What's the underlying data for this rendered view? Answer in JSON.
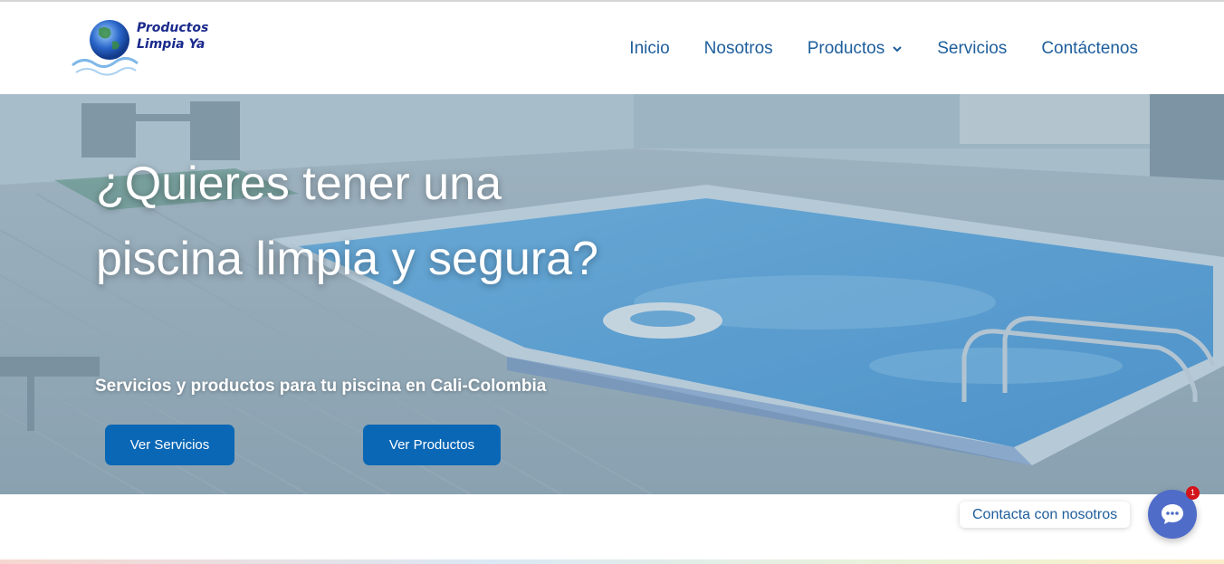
{
  "logo": {
    "line1": "Productos",
    "line2": "Limpia Ya",
    "icon": "globe-water-icon"
  },
  "nav": {
    "items": [
      {
        "label": "Inicio"
      },
      {
        "label": "Nosotros"
      },
      {
        "label": "Productos",
        "icon": "chevron-down-icon"
      },
      {
        "label": "Servicios"
      },
      {
        "label": "Contáctenos"
      }
    ]
  },
  "hero": {
    "title": "¿Quieres tener una piscina limpia y segura?",
    "subtitle": "Servicios y productos para tu piscina en Cali-Colombia",
    "buttons": [
      {
        "label": "Ver Servicios"
      },
      {
        "label": "Ver Productos"
      }
    ]
  },
  "chat": {
    "label": "Contacta con nosotros",
    "badge": "1",
    "icon": "chat-bubble-icon"
  },
  "colors": {
    "nav_text": "#1e5e9b",
    "button_bg": "#0a67b5",
    "chat_bg": "#4f6cc9",
    "badge_bg": "#d3141a"
  }
}
